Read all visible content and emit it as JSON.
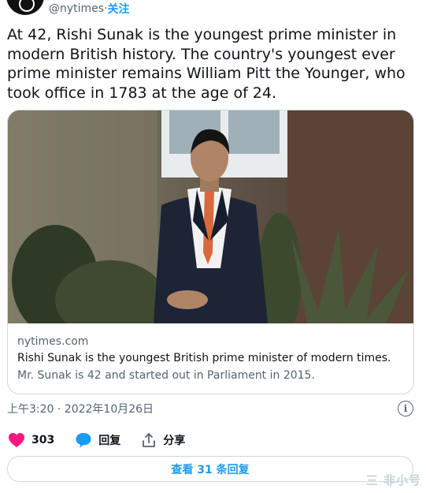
{
  "header": {
    "handle": "@nytimes",
    "separator": " · ",
    "follow_label": "关注"
  },
  "tweet": {
    "text": "At 42, Rishi Sunak is the youngest prime minister in modern British history. The country's youngest ever prime minister remains William Pitt the Younger, who took office in 1783 at the age of 24."
  },
  "card": {
    "domain": "nytimes.com",
    "title": "Rishi Sunak is the youngest British prime minister of modern times.",
    "description": "Mr. Sunak is 42 and started out in Parliament in 2015."
  },
  "meta": {
    "timestamp": "上午3:20 · 2022年10月26日",
    "info_icon": "i"
  },
  "actions": {
    "like_count": "303",
    "reply_label": "回复",
    "share_label": "分享"
  },
  "replies_button": {
    "label": "查看 31 条回复"
  },
  "watermark": "三 非小号",
  "colors": {
    "accent": "#1d9bf0",
    "like": "#f91880",
    "text": "#0f1419",
    "muted": "#536471",
    "border": "#cfd9de"
  }
}
